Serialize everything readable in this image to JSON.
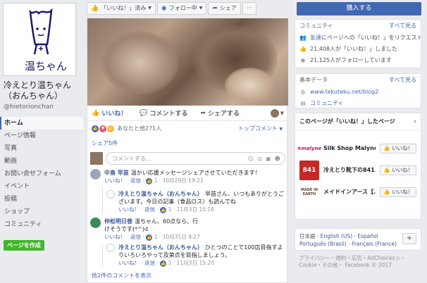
{
  "page": {
    "name": "冷えとり温ちゃん（おんちゃん）",
    "handle": "@hietorionchan",
    "logo_text": "温ちゃん"
  },
  "nav": [
    {
      "label": "ホーム",
      "active": true
    },
    {
      "label": "ページ情報"
    },
    {
      "label": "写真"
    },
    {
      "label": "動画"
    },
    {
      "label": "お問い合せフォーム"
    },
    {
      "label": "イベント"
    },
    {
      "label": "投稿"
    },
    {
      "label": "ショップ"
    },
    {
      "label": "コミュニティ"
    }
  ],
  "create_page_label": "ページを作成",
  "actionbar": {
    "liked_label": "「いいね！」済み",
    "following_label": "フォロー中",
    "share_label": "シェア",
    "more_label": "···"
  },
  "post": {
    "like_label": "いいね！",
    "comment_label": "コメントする",
    "share_label": "シェアする",
    "reaction_summary": "あなたと他271人",
    "top_comments_label": "トップコメント",
    "share_count": "シェア5件",
    "comment_placeholder": "コメントする...",
    "more_comments": "他2件のコメントを表示"
  },
  "comments": [
    {
      "author": "中島 早苗",
      "text": "温かい応援メッセージシェアさせていただきます！",
      "like": "いいね！",
      "reply": "返信",
      "count": "1",
      "time": "10月29日 19:21"
    },
    {
      "author": "冷えとり温ちゃん（おんちゃん）",
      "text": "早苗さん、いつもありがとうございます。今日の記事（食品ロス）も読んでね",
      "like": "いいね！",
      "reply": "返信",
      "count": "1",
      "time": "11月3日 15:18"
    },
    {
      "author": "仲松明日香",
      "text": "温ちゃん、60点なら、行けそうです(*^)d",
      "like": "いいね！",
      "reply": "返信",
      "count": "1",
      "time": "10月31日 9:27"
    },
    {
      "author": "冷えとり温ちゃん（おんちゃん）",
      "text": "ひとつのことで100店目指すよりいろいろやって及第点を目指しましょう。",
      "like": "いいね！",
      "reply": "返信",
      "count": "1",
      "time": "11月3日 15:20"
    }
  ],
  "right": {
    "buy_label": "購入する",
    "community": {
      "title": "コミュニティ",
      "see_all": "すべて見る",
      "invite_prefix": "友達",
      "invite_text": "にページへの「いいね！」をリクエスト",
      "likes_text": "21,408人が「いいね！」しました",
      "follows_text": "21,125人がフォローしています"
    },
    "about": {
      "title": "基本データ",
      "see_all": "すべて見る",
      "url": "www.tekuteku.net/blog2",
      "category": "コミュニティ"
    },
    "liked_pages": {
      "title": "このページが「いいね！」したページ",
      "items": [
        {
          "name": "Silk Shop Malyne",
          "logo": "malyne",
          "like": "いいね！"
        },
        {
          "name": "冷えとり靴下の841...",
          "logo": "841",
          "like": "いいね！"
        },
        {
          "name": "メイドインアース【...",
          "logo": "MADE IN EARTH",
          "like": "いいね！"
        }
      ]
    },
    "languages": {
      "current": "日本語",
      "others": [
        "English (US)",
        "Español",
        "Português (Brasil)",
        "Français (France)"
      ]
    },
    "footer": "プライバシー・規約・広告・AdChoices ▷・Cookie・その他・ Facebook © 2017",
    "accent": "#4267b2"
  }
}
